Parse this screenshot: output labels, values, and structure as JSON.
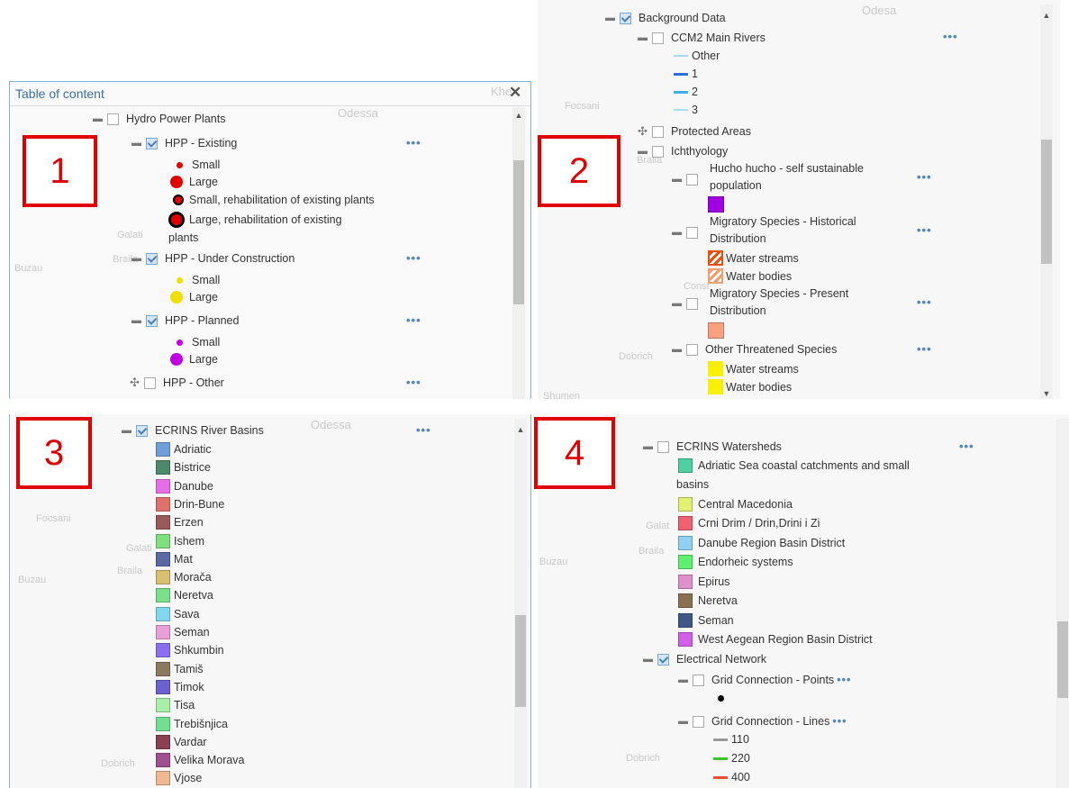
{
  "markers": [
    "1",
    "2",
    "3",
    "4"
  ],
  "panel1": {
    "title": "Table of content",
    "map_labels": [
      "Khe",
      "Odessa",
      "Galati",
      "Braila",
      "Buzau"
    ],
    "root": "Hydro Power Plants",
    "layers": [
      {
        "name": "HPP - Existing",
        "legend": [
          "Small",
          "Large",
          "Small, rehabilitation of existing plants",
          "Large, rehabilitation of existing",
          "plants"
        ]
      },
      {
        "name": "HPP - Under Construction",
        "legend": [
          "Small",
          "Large"
        ]
      },
      {
        "name": "HPP - Planned",
        "legend": [
          "Small",
          "Large"
        ]
      },
      {
        "name": "HPP - Other"
      }
    ]
  },
  "panel2": {
    "map_labels": [
      "Odesa",
      "Focsani",
      "Braila",
      "Dobrich",
      "Shumen",
      "Const"
    ],
    "root": "Background Data",
    "rivers": {
      "name": "CCM2 Main Rivers",
      "legend": [
        "Other",
        "1",
        "2",
        "3"
      ]
    },
    "protected": "Protected Areas",
    "ichthyology": "Ichthyology",
    "hucho": {
      "name_line1": "Hucho hucho - self sustainable",
      "name_line2": "population"
    },
    "migratory_hist": {
      "name_line1": "Migratory Species - Historical",
      "name_line2": "Distribution",
      "legend": [
        "Water streams",
        "Water bodies"
      ]
    },
    "migratory_present": {
      "name_line1": "Migratory Species - Present",
      "name_line2": "Distribution"
    },
    "other_threatened": {
      "name": "Other Threatened Species",
      "legend": [
        "Water streams",
        "Water bodies"
      ]
    }
  },
  "panel3": {
    "map_labels": [
      "Odessa",
      "Focsani",
      "Galati",
      "Braila",
      "Buzau",
      "Dobrich"
    ],
    "root": "ECRINS River Basins",
    "items": [
      {
        "label": "Adriatic",
        "color": "#6f9fd8"
      },
      {
        "label": "Bistrice",
        "color": "#4a8a6a"
      },
      {
        "label": "Danube",
        "color": "#e86ee8"
      },
      {
        "label": "Drin-Bune",
        "color": "#e0706a"
      },
      {
        "label": "Erzen",
        "color": "#9a5a5a"
      },
      {
        "label": "Ishem",
        "color": "#7ee07e"
      },
      {
        "label": "Mat",
        "color": "#5a6aa0"
      },
      {
        "label": "Morača",
        "color": "#d8c070"
      },
      {
        "label": "Neretva",
        "color": "#7ae08a"
      },
      {
        "label": "Sava",
        "color": "#80d8f0"
      },
      {
        "label": "Seman",
        "color": "#e8a0d8"
      },
      {
        "label": "Shkumbin",
        "color": "#8a70f0"
      },
      {
        "label": "Tamiš",
        "color": "#8a7a60"
      },
      {
        "label": "Timok",
        "color": "#6a60d0"
      },
      {
        "label": "Tisa",
        "color": "#a8f0a8"
      },
      {
        "label": "Trebišnjica",
        "color": "#70e090"
      },
      {
        "label": "Vardar",
        "color": "#8a4050"
      },
      {
        "label": "Velika Morava",
        "color": "#a05090"
      },
      {
        "label": "Vjose",
        "color": "#f0b890"
      }
    ]
  },
  "panel4": {
    "map_labels": [
      "Galat",
      "Braila",
      "Buzau",
      "Dobrich"
    ],
    "root": "ECRINS Watersheds",
    "items": [
      {
        "label": "Adriatic Sea coastal catchments and small",
        "label2": "basins",
        "color": "#50d0a0"
      },
      {
        "label": "Central Macedonia",
        "color": "#e0f070"
      },
      {
        "label": "Crni Drim / Drin,Drini i Zi",
        "color": "#f06070"
      },
      {
        "label": "Danube Region Basin District",
        "color": "#90d0f0"
      },
      {
        "label": "Endorheic systems",
        "color": "#60f070"
      },
      {
        "label": "Epirus",
        "color": "#e090c8"
      },
      {
        "label": "Neretva",
        "color": "#8a7050"
      },
      {
        "label": "Seman",
        "color": "#405888"
      },
      {
        "label": "West Aegean Region Basin District",
        "color": "#d060e8"
      }
    ],
    "electrical": "Electrical Network",
    "grid_points": "Grid Connection - Points",
    "grid_lines": {
      "name": "Grid Connection - Lines",
      "legend": [
        "110",
        "220",
        "400"
      ]
    }
  },
  "colors": {
    "accent": "#4f86c6",
    "marker": "#e00000"
  },
  "icons": {
    "more": "•••",
    "collapse": "minus-icon",
    "expand": "plus-icon",
    "close": "close-icon"
  }
}
